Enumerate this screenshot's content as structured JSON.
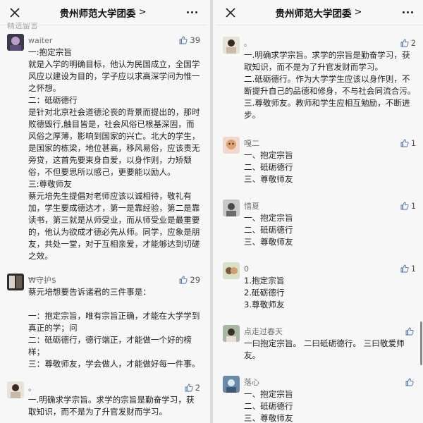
{
  "left": {
    "title": "贵州师范大学团委",
    "chevron": ">",
    "cut_text": "精选留言",
    "comments": [
      {
        "name": "waiter",
        "likes": "39",
        "text": "一:抱定宗旨\n就是入学的明确目标，他认为民国成立，全国学风应以建设为目的，学子应以求高深学问为惟一之怀想。\n二：砥砺德行\n是针对北京社会道德沦丧的背景而提出的，那时败德毁行,触目皆是，社会风俗已根基深固，而风俗之厚薄，影响到国家的兴亡。北大的学生，是国家的栋梁，地位甚高，移风易俗，应该责无旁贷，这首先要束身自爱，以身作则，力矫颓俗，不但要思所以感己，更要能以励人。\n三:尊敬师友\n蔡元培先生提倡对老师应该以诚相待，敬礼有加，学生要成德达才，第一是靠经验，第二是靠读书，第三就是从师受业，而从师受业是最重要的，他认为欲成才德必先从师。同学，应象是朋友，共处一堂，对于互相亲爱，才能够达到切磋之效。"
      },
      {
        "name": "₩守护$",
        "likes": "29",
        "text": "蔡元培想要告诉诸君的三件事是：\n\n一：抱定宗旨，唯有宗旨正确，才能在大学学到真正的学；问\n二：砥砺德行，德行端正，才能做一个好的榜样；\n三：尊敬师友，学会做人，才能做好每一件事。"
      },
      {
        "name": "。",
        "likes": "2",
        "text": "一.明确求学宗旨。求学的宗旨是勤奋学习，获取知识，而不是为了升官发财而学习。"
      }
    ]
  },
  "right": {
    "title": "贵州师范大学团委",
    "chevron": ">",
    "comments": [
      {
        "name": "。",
        "likes": "2",
        "text": "一.明确求学宗旨。求学的宗旨是勤奋学习，获取知识，而不是为了升官发财而学习。\n二.砥砺德行。作为大学学生应该以身作则，不断提升自己的品德和修身，不与社会同流合污。\n三.尊敬师友。教师和学生应相互勉励，不断进步。"
      },
      {
        "name": "嘎二",
        "likes": "1",
        "text": "一、抱定宗旨\n二、砥砺德行\n三、尊敬师友"
      },
      {
        "name": "惜夏",
        "likes": "1",
        "text": "一、抱定宗旨\n二、砥砺德行\n三、尊敬师友"
      },
      {
        "name": "0",
        "likes": "1",
        "text": "1.抱定宗旨\n2.砥砺德行\n3.尊敬师友"
      },
      {
        "name": "点走过春天",
        "likes": "",
        "text": "一曰抱定宗旨。 二曰砥砺德行。 三曰敬爱师友。"
      },
      {
        "name": "落心",
        "likes": "",
        "text": "一、抱定宗旨\n二、砥砺德行\n三、尊敬师友"
      }
    ]
  },
  "icons": {
    "close": "close-icon",
    "more": "more-icon",
    "like": "thumbs-up-icon"
  },
  "colors": {
    "background": "#f7f7f7",
    "name": "#707070",
    "text": "#222222"
  }
}
